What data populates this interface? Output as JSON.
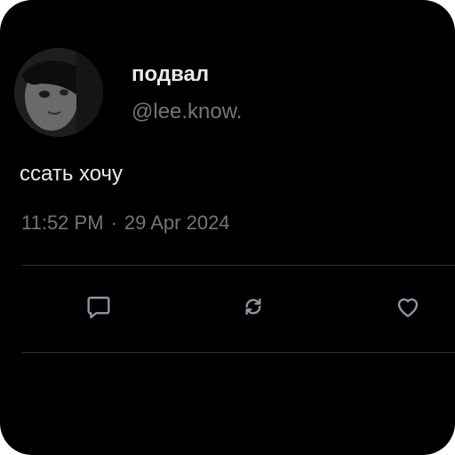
{
  "tweet": {
    "display_name": "подвал",
    "handle": "@lee.know.",
    "text": "ссать хочу",
    "time": "11:52 PM",
    "separator": "·",
    "date": "29 Apr 2024"
  },
  "actions": [
    {
      "icon": "reply-icon"
    },
    {
      "icon": "retweet-icon"
    },
    {
      "icon": "like-icon"
    }
  ],
  "colors": {
    "background": "#000000",
    "primary_text": "#e7e9ea",
    "secondary_text": "#71767b",
    "divider": "#2f3336",
    "icon": "#8b98a5"
  }
}
